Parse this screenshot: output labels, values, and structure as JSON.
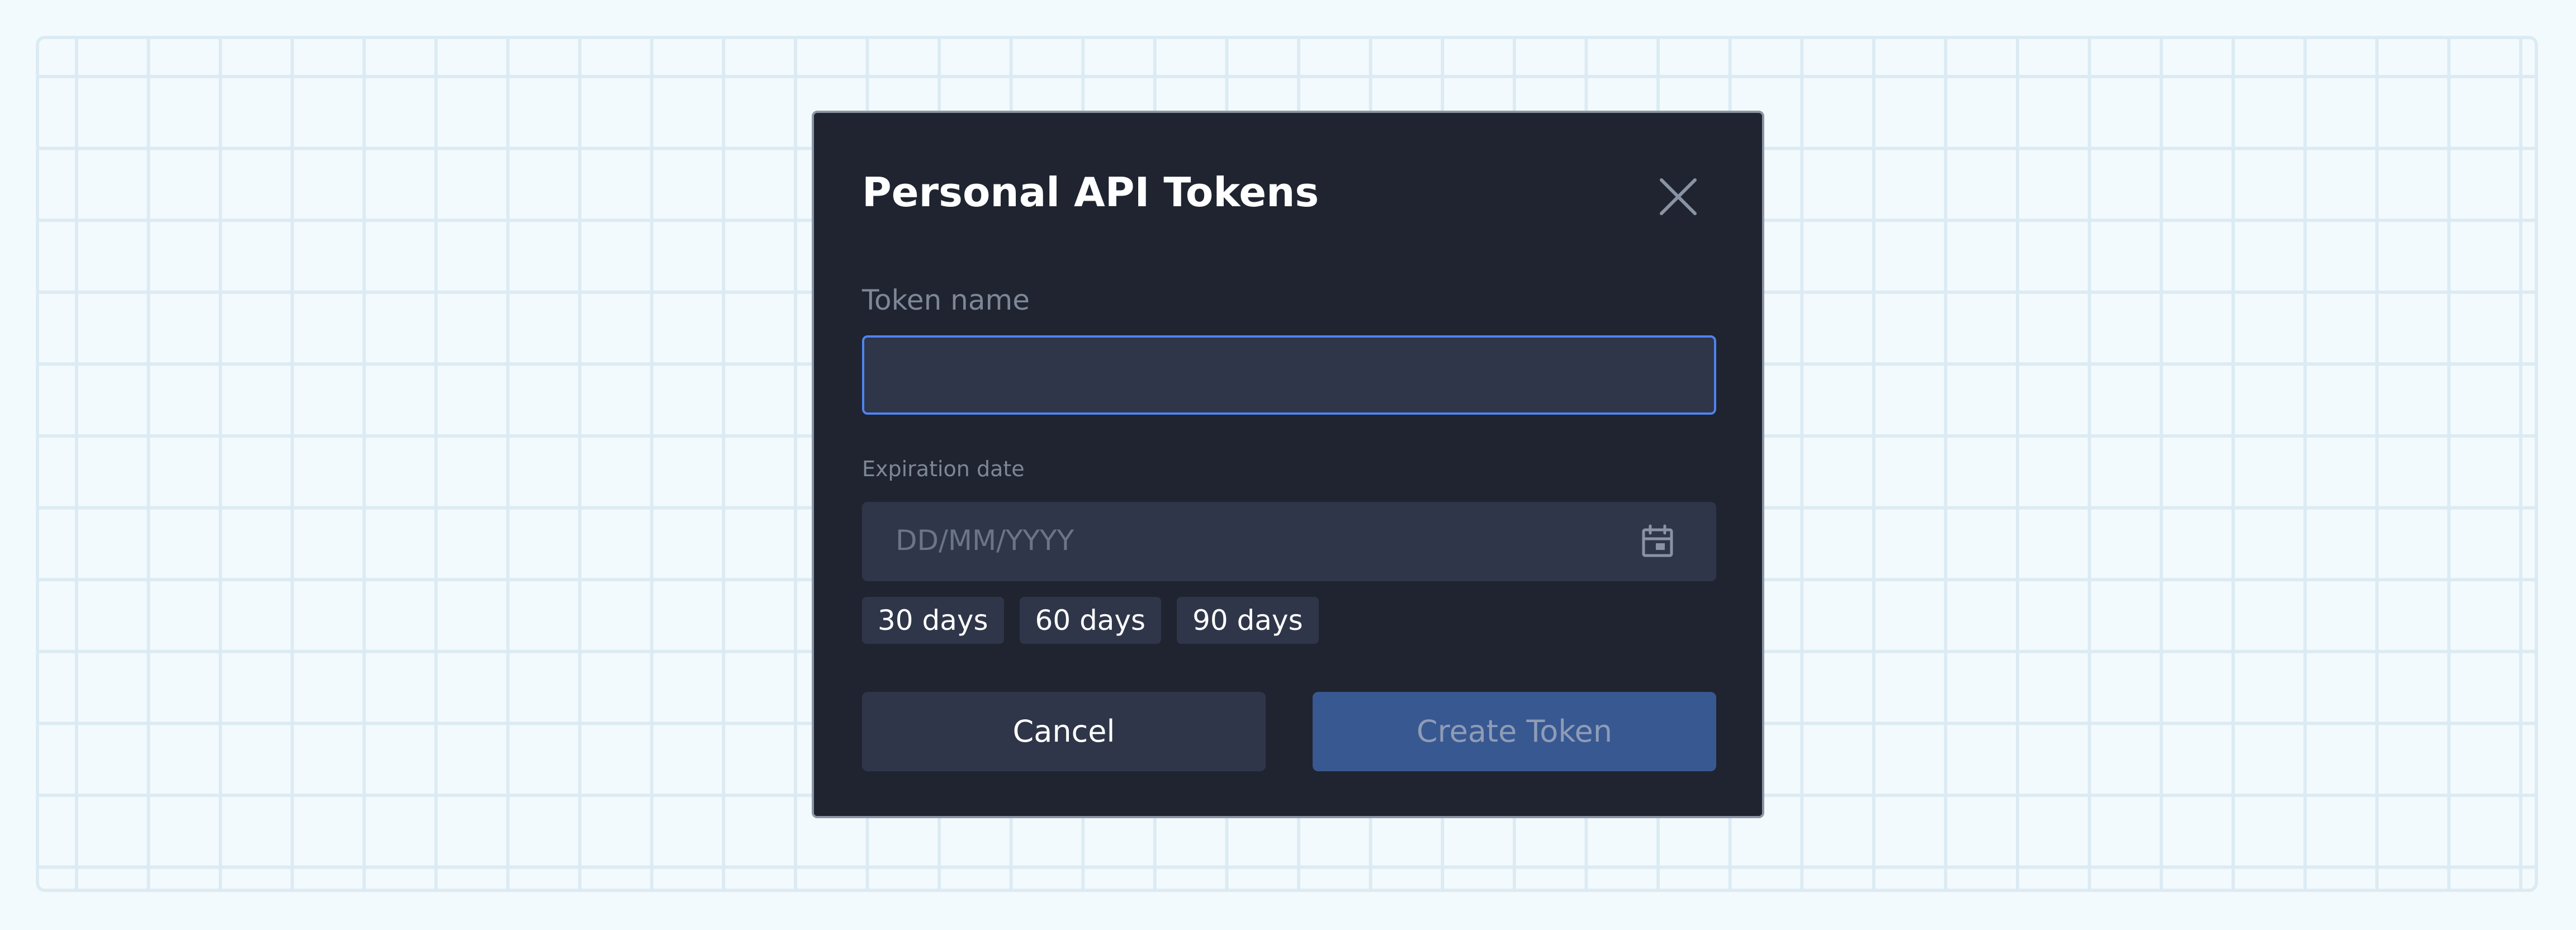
{
  "dialog": {
    "title": "Personal API Tokens",
    "close_icon": "close-icon"
  },
  "token_name": {
    "label": "Token name",
    "value": "",
    "placeholder": ""
  },
  "expiration": {
    "label": "Expiration date",
    "placeholder": "DD/MM/YYYY",
    "calendar_icon": "calendar-icon",
    "presets": [
      "30 days",
      "60 days",
      "90 days"
    ]
  },
  "actions": {
    "cancel_label": "Cancel",
    "create_label": "Create Token",
    "create_disabled": true
  },
  "colors": {
    "modal_bg": "#1f2430",
    "field_bg": "#2f3649",
    "focus_border": "#4f83f0",
    "primary_button": "#385891",
    "page_grid": "#dcebf3"
  }
}
